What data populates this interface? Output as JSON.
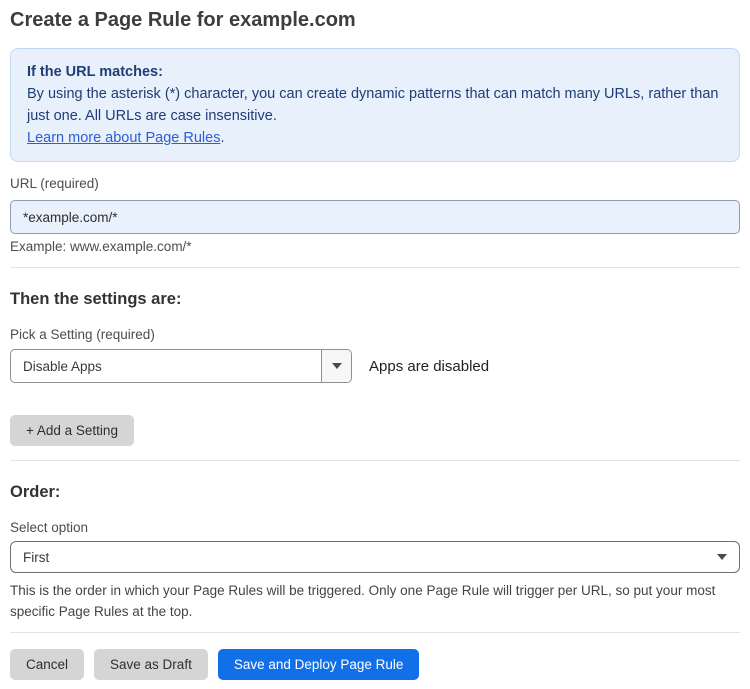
{
  "page": {
    "title": "Create a Page Rule for example.com"
  },
  "info_box": {
    "heading": "If the URL matches:",
    "body": "By using the asterisk (*) character, you can create dynamic patterns that can match many URLs, rather than just one. All URLs are case insensitive.",
    "link": "Learn more about Page Rules",
    "link_suffix": "."
  },
  "url_field": {
    "label": "URL (required)",
    "value": "*example.com/*",
    "hint": "Example: www.example.com/*"
  },
  "settings_section": {
    "heading": "Then the settings are:",
    "picker_label": "Pick a Setting (required)",
    "selected_setting": "Disable Apps",
    "status_text": "Apps are disabled",
    "add_button_label": "+ Add a Setting"
  },
  "order_section": {
    "heading": "Order:",
    "select_label": "Select option",
    "selected_option": "First",
    "description": "This is the order in which your Page Rules will be triggered. Only one Page Rule will trigger per URL, so put your most specific Page Rules at the top."
  },
  "footer": {
    "cancel_label": "Cancel",
    "save_draft_label": "Save as Draft",
    "save_deploy_label": "Save and Deploy Page Rule"
  },
  "icons": {
    "setting_caret": "caret-down",
    "order_caret": "caret-down"
  },
  "colors": {
    "info_box_bg": "#e7f0fb",
    "info_box_border": "#c3d9f1",
    "info_text": "#1f3d77",
    "link_blue": "#2b5ed7",
    "input_bg": "#e8f1fc",
    "primary_button_bg": "#1170e8",
    "gray_button_bg": "#d5d5d5"
  }
}
